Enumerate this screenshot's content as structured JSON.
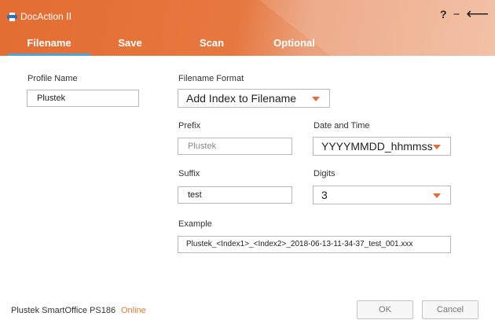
{
  "app": {
    "title": "DocAction ⅠⅠ"
  },
  "window_buttons": {
    "help": "?",
    "minimize": "−",
    "back": "⟵"
  },
  "tabs": [
    {
      "label": "Filename",
      "active": true
    },
    {
      "label": "Save",
      "active": false
    },
    {
      "label": "Scan",
      "active": false
    },
    {
      "label": "Optional",
      "active": false
    }
  ],
  "profile": {
    "label": "Profile Name",
    "value": "Plustek"
  },
  "filename_format": {
    "label": "Filename Format",
    "value": "Add Index to Filename"
  },
  "prefix": {
    "label": "Prefix",
    "value": "Plustek"
  },
  "date_time": {
    "label": "Date and Time",
    "value": "YYYYMMDD_hhmmss"
  },
  "suffix": {
    "label": "Suffix",
    "value": "test"
  },
  "digits": {
    "label": "Digits",
    "value": "3"
  },
  "example": {
    "label": "Example",
    "value": "Plustek_<Index1>_<Index2>_2018-06-13-11-34-37_test_001.xxx"
  },
  "footer": {
    "model": "Plustek SmartOffice PS186",
    "status": "Online"
  },
  "buttons": {
    "ok": "OK",
    "cancel": "Cancel"
  },
  "colors": {
    "accent": "#e36d33",
    "tab_underline": "#4aa4d9",
    "status_online": "#e87a3a"
  }
}
